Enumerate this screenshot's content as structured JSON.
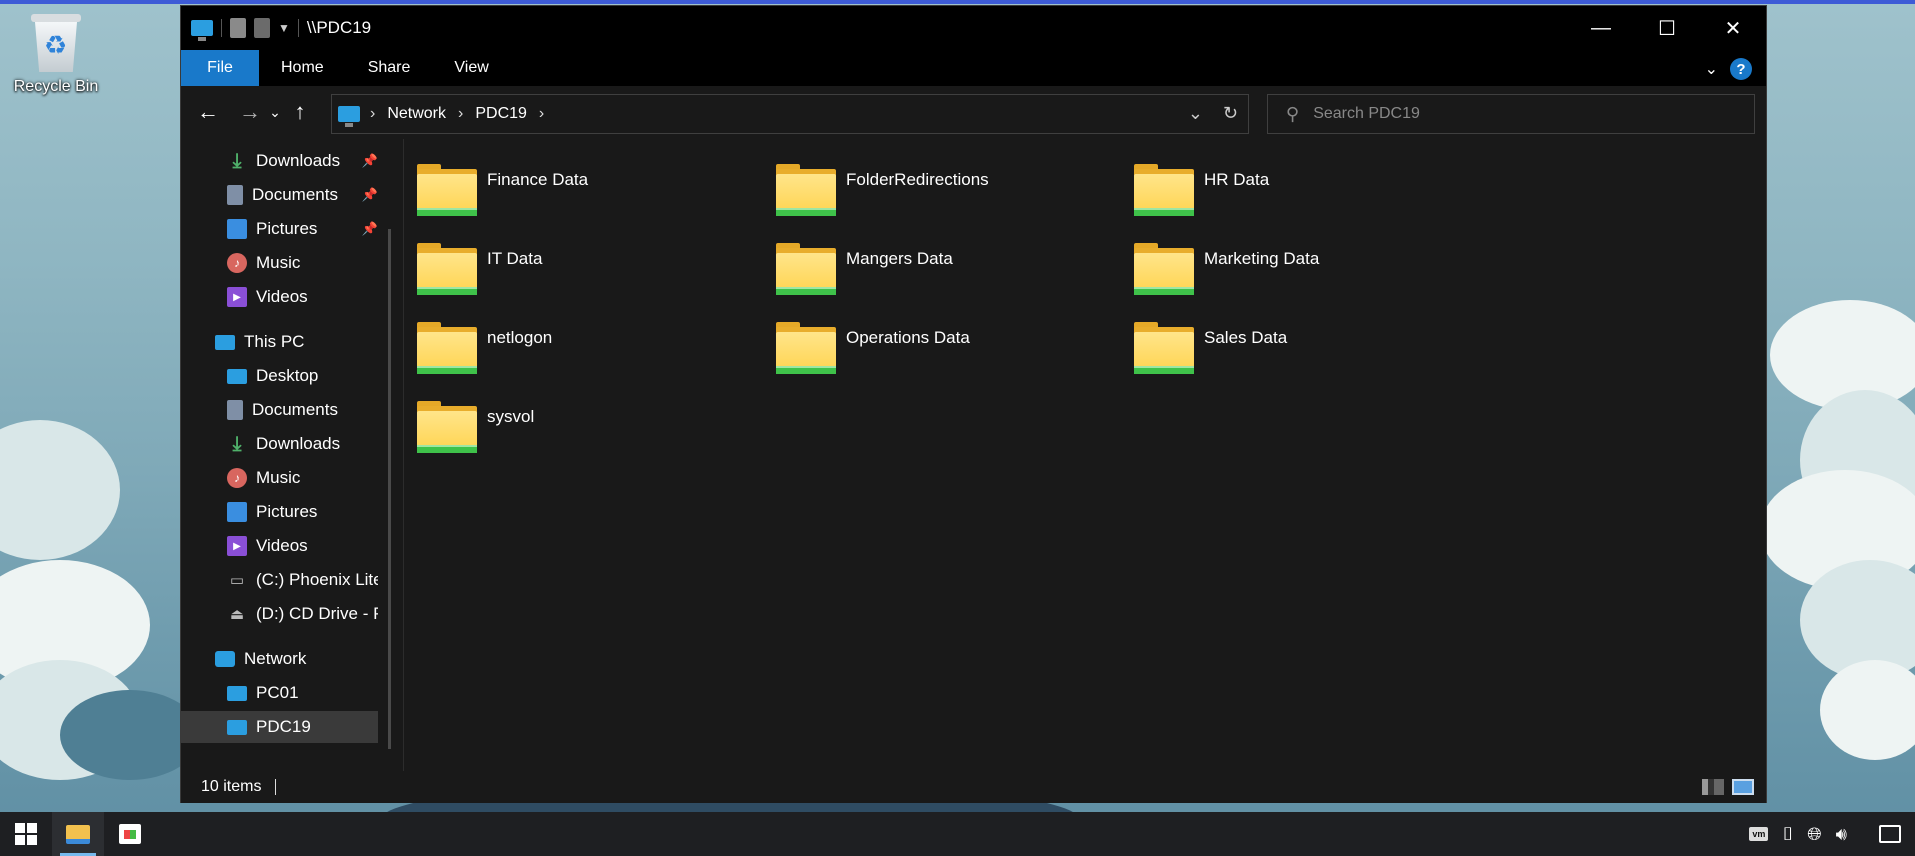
{
  "desktop": {
    "recycle_bin_label": "Recycle Bin"
  },
  "window": {
    "title": "\\\\PDC19",
    "controls": {
      "minimize": "—",
      "maximize": "☐",
      "close": "✕"
    }
  },
  "ribbon": {
    "tabs": [
      "File",
      "Home",
      "Share",
      "View"
    ]
  },
  "address": {
    "crumbs": [
      "Network",
      "PDC19"
    ],
    "search_placeholder": "Search PDC19"
  },
  "sidebar": {
    "quick_access": [
      {
        "label": "Downloads",
        "icon": "downloads-icon",
        "pinned": true
      },
      {
        "label": "Documents",
        "icon": "documents-icon",
        "pinned": true
      },
      {
        "label": "Pictures",
        "icon": "pictures-icon",
        "pinned": true
      },
      {
        "label": "Music",
        "icon": "music-icon",
        "pinned": false
      },
      {
        "label": "Videos",
        "icon": "videos-icon",
        "pinned": false
      }
    ],
    "this_pc": "This PC",
    "this_pc_items": [
      {
        "label": "Desktop",
        "icon": "desktop-icon"
      },
      {
        "label": "Documents",
        "icon": "documents-icon"
      },
      {
        "label": "Downloads",
        "icon": "downloads-icon"
      },
      {
        "label": "Music",
        "icon": "music-icon"
      },
      {
        "label": "Pictures",
        "icon": "pictures-icon"
      },
      {
        "label": "Videos",
        "icon": "videos-icon"
      },
      {
        "label": "(C:) Phoenix Lite",
        "icon": "drive-icon"
      },
      {
        "label": "(D:) CD Drive - P",
        "icon": "cd-drive-icon"
      }
    ],
    "network": "Network",
    "network_items": [
      {
        "label": "PC01",
        "icon": "computer-icon",
        "selected": false
      },
      {
        "label": "PDC19",
        "icon": "computer-icon",
        "selected": true
      }
    ]
  },
  "folders": [
    "Finance Data",
    "FolderRedirections",
    "HR Data",
    "IT Data",
    "Mangers Data",
    "Marketing Data",
    "netlogon",
    "Operations Data",
    "Sales Data",
    "sysvol"
  ],
  "status": {
    "item_count": "10 items"
  },
  "colors": {
    "accent": "#1979ca",
    "window_bg": "#191919",
    "folder_yellow": "#ffd34e",
    "share_green": "#3fc24a"
  }
}
